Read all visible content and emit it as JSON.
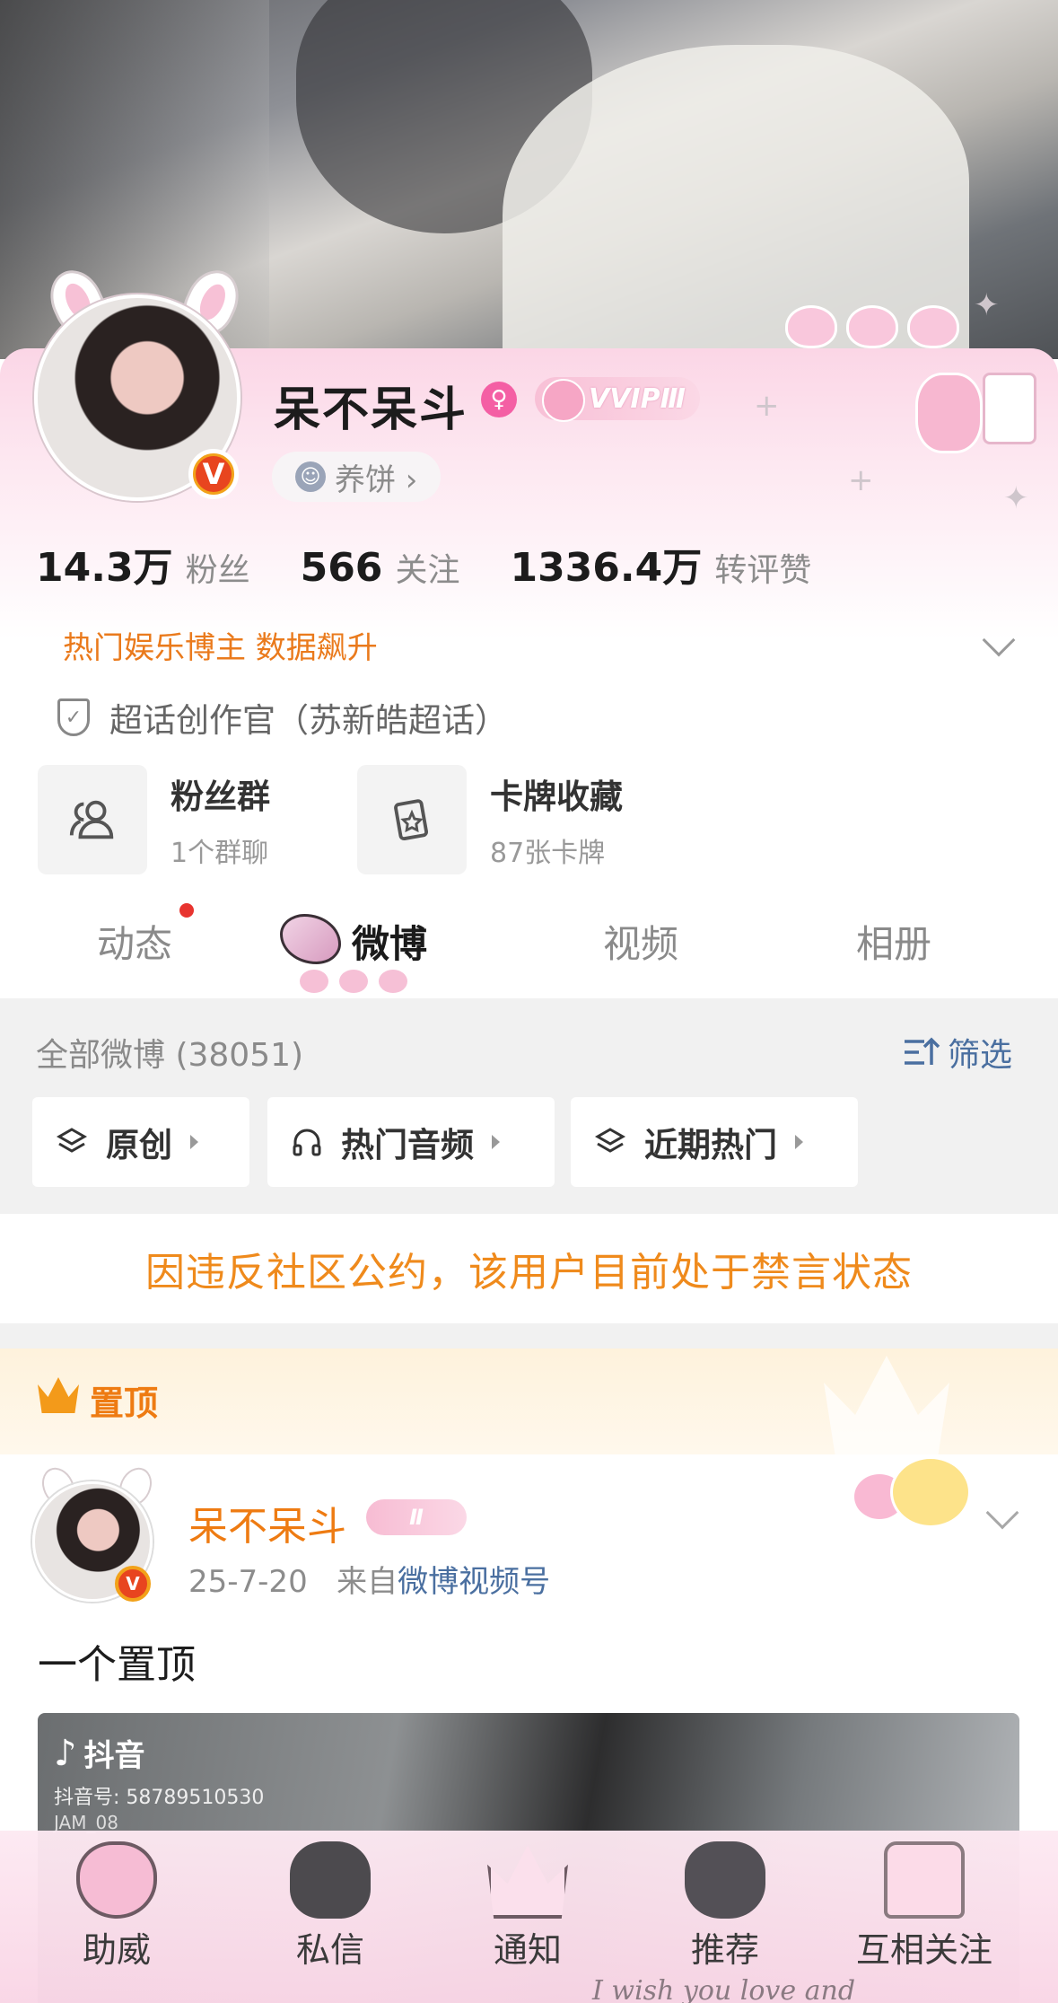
{
  "profile": {
    "name": "呆不呆斗",
    "gender_symbol": "♀",
    "vip_label": "VVIPⅢ",
    "tag_label": "养饼 ›",
    "stats": [
      {
        "value": "14.3万",
        "label": "粉丝"
      },
      {
        "value": "566",
        "label": "关注"
      },
      {
        "value": "1336.4万",
        "label": "转评赞"
      }
    ],
    "hot_text": "热门娱乐博主 数据飙升",
    "badge_text": "超话创作官（苏新皓超话）",
    "verified_symbol": "V",
    "entries": [
      {
        "title": "粉丝群",
        "sub": "1个群聊",
        "icon": "people-icon"
      },
      {
        "title": "卡牌收藏",
        "sub": "87张卡牌",
        "icon": "card-icon"
      }
    ]
  },
  "tabs": [
    "动态",
    "微博",
    "视频",
    "相册"
  ],
  "active_tab": "微博",
  "filter": {
    "all_count": "全部微博 (38051)",
    "filter_label": "筛选",
    "chips": [
      "原创",
      "热门音频",
      "近期热门"
    ]
  },
  "notice": "因违反社区公约，该用户目前处于禁言状态",
  "pinned": {
    "label": "置顶",
    "author": "呆不呆斗",
    "vip": "Ⅱ",
    "date": "25-7-20",
    "from": "来自",
    "source": "微博视频号",
    "text": "一个置顶",
    "media": {
      "app": "抖音",
      "id": "抖音号: 58789510530",
      "loc": "JAM_08"
    }
  },
  "bottom_nav": [
    {
      "label": "助威",
      "icon": "heart-icon"
    },
    {
      "label": "私信",
      "icon": "bear-icon"
    },
    {
      "label": "通知",
      "icon": "crown-icon"
    },
    {
      "label": "推荐",
      "icon": "bunny-icon"
    },
    {
      "label": "互相关注",
      "icon": "cake-icon"
    }
  ],
  "bottom_script": "I wish you love and",
  "colors": {
    "accent_orange": "#ee7b12",
    "link_blue": "#4a6fa0",
    "notice_orange": "#ef8a1c",
    "pink": "#f6c0d6"
  }
}
